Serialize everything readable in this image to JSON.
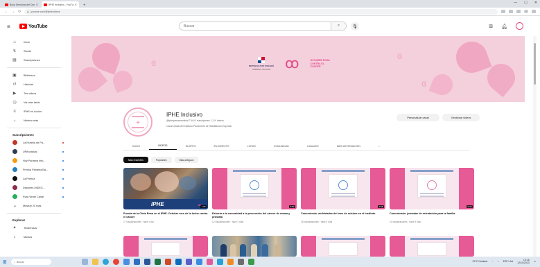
{
  "browser": {
    "tabs": [
      {
        "title": "Boca Servicios del Cáncer - Yo",
        "active": false
      },
      {
        "title": "IPHE Inclusivo - YouTube",
        "active": true
      }
    ],
    "url": "youtube.com/@iphe/videos"
  },
  "header": {
    "logo_text": "YouTube",
    "search_placeholder": "Buscar"
  },
  "sidebar": {
    "main": [
      {
        "icon": "home-icon",
        "glyph": "⌂",
        "label": "Inicio"
      },
      {
        "icon": "shorts-icon",
        "glyph": "↯",
        "label": "Shorts"
      },
      {
        "icon": "subscriptions-icon",
        "glyph": "▤",
        "label": "Suscripciones"
      }
    ],
    "library": [
      {
        "icon": "library-icon",
        "glyph": "▣",
        "label": "Biblioteca"
      },
      {
        "icon": "history-icon",
        "glyph": "↺",
        "label": "Historial"
      },
      {
        "icon": "your-videos-icon",
        "glyph": "▶",
        "label": "Tus videos"
      },
      {
        "icon": "watch-later-icon",
        "glyph": "◷",
        "label": "Ver más tarde"
      },
      {
        "icon": "playlist-icon",
        "glyph": "≡",
        "label": "IPHE en Acción"
      },
      {
        "icon": "chevron-down-icon",
        "glyph": "⌄",
        "label": "Mostrar más"
      }
    ],
    "subscriptions_heading": "Suscripciones",
    "subscriptions": [
      {
        "label": "La Estrella de Pa...",
        "color": "#c0392b",
        "dot": "red"
      },
      {
        "label": "UPAnoticias",
        "color": "#2c3e50",
        "dot": "blue"
      },
      {
        "label": "Hoy Panamá Info...",
        "color": "#f39c12",
        "dot": "blue"
      },
      {
        "label": "Prensa Panamá Ba...",
        "color": "#2980b9",
        "dot": "blue"
      },
      {
        "label": "La Prensa",
        "color": "#111111",
        "dot": "blue"
      },
      {
        "label": "Deportes MIDES...",
        "color": "#8e2b4d",
        "dot": "blue"
      },
      {
        "label": "Ruta Verde Canal",
        "color": "#27ae60",
        "dot": "blue"
      },
      {
        "label": "Mostrar 20 más",
        "color": "",
        "dot": ""
      }
    ],
    "explore_heading": "Explorar",
    "explore": [
      {
        "icon": "trending-icon",
        "glyph": "✦",
        "label": "Tendencias"
      },
      {
        "icon": "music-icon",
        "glyph": "♪",
        "label": "Música"
      }
    ]
  },
  "banner": {
    "gov_label": "REPÚBLICA DE PANAMÁ",
    "gov_sublabel": "GOBIERNO NACIONAL",
    "campaign_text": "OCTUBRE ROSA CONTRA EL CÁNCER"
  },
  "channel": {
    "name": "IPHE Inclusivo",
    "meta": "@iphepanamaoficial  7,46 K suscriptores  1,2 K videos",
    "description": "Canal oficial del Instituto Panameño de Habilitación Especial",
    "subscribe_label": "Personalizar canal",
    "manage_label": "Gestionar videos"
  },
  "tabs": [
    "INICIO",
    "VIDEOS",
    "SHORTS",
    "EN DIRECTO",
    "LISTAS",
    "COMUNIDAD",
    "CANALES",
    "MÁS INFORMACIÓN"
  ],
  "chips": [
    "Más recientes",
    "Populares",
    "Más antiguos"
  ],
  "videos": [
    {
      "title": "Puesta de la Cinta Rosa en el IPHE. Octubre mes de la lucha contra el cáncer",
      "meta": "17 visualizaciones · hace 1 día",
      "duration": "1:05"
    },
    {
      "title": "Exhorto a la comunidad a la prevención del cáncer de mama y próstata",
      "meta": "12 visualizaciones · hace 2 días",
      "duration": "0:52"
    },
    {
      "title": "Comunicado: actividades del mes de octubre en el Instituto",
      "meta": "15 visualizaciones · hace 2 días",
      "duration": "0:48"
    },
    {
      "title": "Comunicado: jornadas de orientación para la familia",
      "meta": "11 visualizaciones · hace 3 días",
      "duration": "0:44"
    }
  ],
  "colors": {
    "brand_red": "#ff0000",
    "banner_pink": "#f4cfdc",
    "accent_pink": "#e14b87"
  },
  "taskbar": {
    "search_label": "Buscar",
    "weather": "29°C  Nublado",
    "language": "ESP LAA",
    "time": "10:16",
    "date": "12/10/2023"
  }
}
